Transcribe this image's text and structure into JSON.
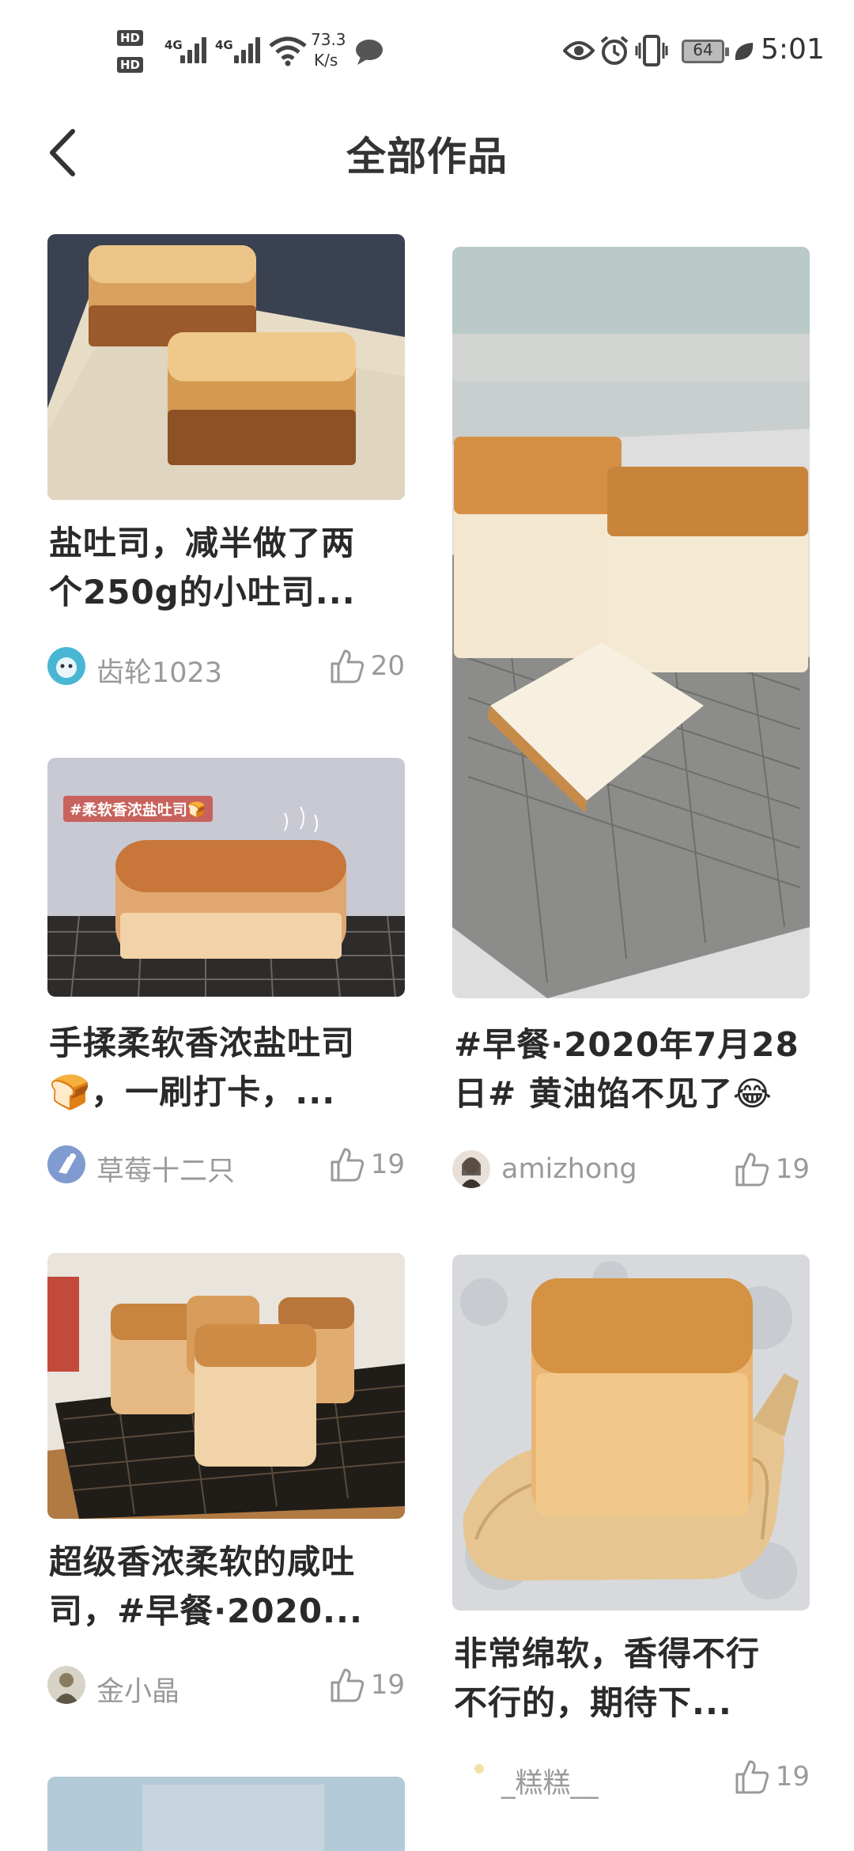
{
  "status_bar": {
    "hd1": "HD",
    "hd2": "HD",
    "net1": "4G",
    "net2": "4G",
    "speed_value": "73.3",
    "speed_unit": "K/s",
    "battery": "64",
    "time": "5:01"
  },
  "header": {
    "title": "全部作品"
  },
  "posts": [
    {
      "title": "盐吐司，减半做了两个250g的小吐司...",
      "title_line1": "盐吐司，减半做了两",
      "title_line2": "个250g的小吐司...",
      "user": "齿轮1023",
      "likes": "20"
    },
    {
      "title": "#早餐·2020年7月28日# 黄油馅不见了😂",
      "title_line1": "#早餐·2020年7月28",
      "title_line2": "日# 黄油馅不见了😂",
      "user": "amizhong",
      "likes": "19"
    },
    {
      "title": "手揉柔软香浓盐吐司🍞，一刷打卡，...",
      "title_line1": "手揉柔软香浓盐吐司",
      "title_line2": "🍞，一刷打卡，...",
      "user": "草莓十二只",
      "likes": "19",
      "image_tag": "#柔软香浓盐吐司🍞"
    },
    {
      "title": "超级香浓柔软的咸吐司，#早餐·2020...",
      "title_line1": "超级香浓柔软的咸吐",
      "title_line2": "司，#早餐·2020...",
      "user": "金小晶",
      "likes": "19"
    },
    {
      "title": "非常绵软，香得不行不行的，期待下...",
      "title_line1": "非常绵软，香得不行",
      "title_line2": "不行的，期待下...",
      "user": "_糕糕__",
      "likes": "19"
    }
  ],
  "icons": {
    "back": "chevron-left-icon",
    "like": "thumbs-up-icon",
    "eye": "eye-icon",
    "alarm": "alarm-icon",
    "vibrate": "vibrate-icon",
    "leaf": "leaf-icon",
    "wifi": "wifi-icon",
    "chat": "chat-bubble-icon"
  }
}
